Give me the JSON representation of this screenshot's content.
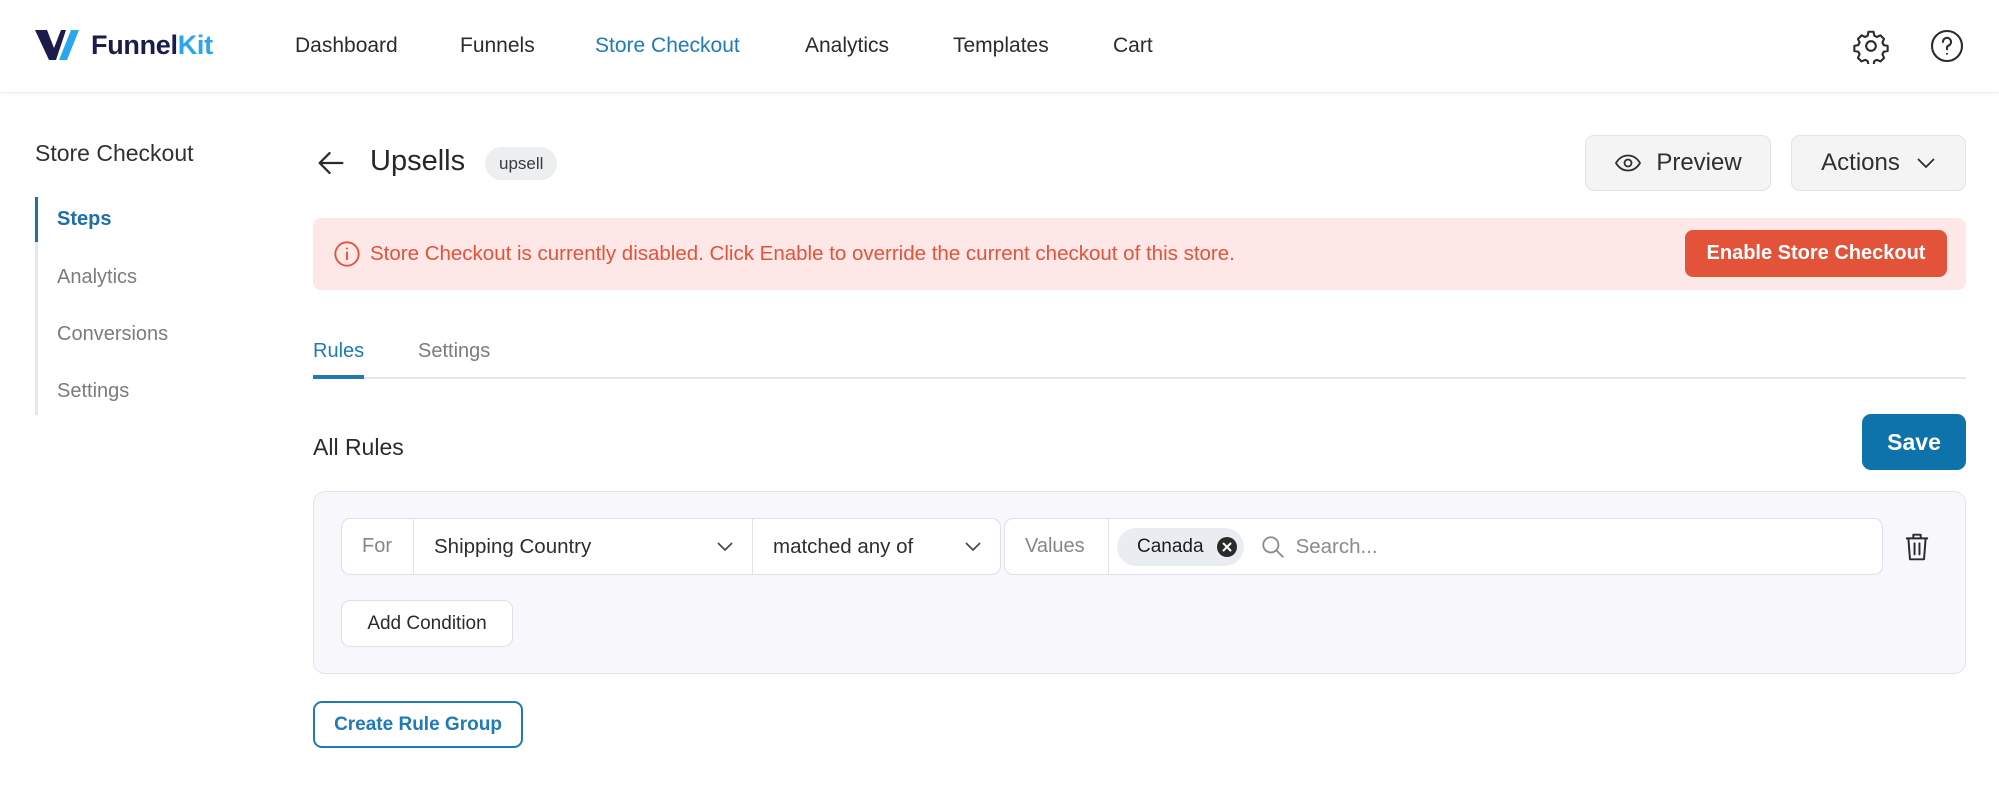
{
  "app": {
    "brand_part1": "Funnel",
    "brand_part2": "Kit",
    "colors": {
      "brand_dark": "#1c1b4d",
      "brand_light": "#2aa6ee",
      "accent": "#1f7ab6",
      "danger": "#e2533a",
      "alert_bg": "#fde7e7"
    }
  },
  "header": {
    "nav": [
      {
        "label": "Dashboard",
        "active": false
      },
      {
        "label": "Funnels",
        "active": false
      },
      {
        "label": "Store Checkout",
        "active": true
      },
      {
        "label": "Analytics",
        "active": false
      },
      {
        "label": "Templates",
        "active": false
      },
      {
        "label": "Cart",
        "active": false
      }
    ],
    "icons": [
      "gear-icon",
      "help-icon"
    ]
  },
  "sidebar": {
    "title": "Store Checkout",
    "items": [
      {
        "label": "Steps",
        "active": true
      },
      {
        "label": "Analytics",
        "active": false
      },
      {
        "label": "Conversions",
        "active": false
      },
      {
        "label": "Settings",
        "active": false
      }
    ]
  },
  "page": {
    "title": "Upsells",
    "badge": "upsell",
    "preview_label": "Preview",
    "actions_label": "Actions"
  },
  "alert": {
    "message": "Store Checkout is currently disabled. Click Enable to override the current checkout of this store.",
    "button_label": "Enable Store Checkout"
  },
  "tabs": [
    {
      "label": "Rules",
      "active": true
    },
    {
      "label": "Settings",
      "active": false
    }
  ],
  "rules": {
    "title": "All Rules",
    "save_label": "Save",
    "conditions": [
      {
        "for_label": "For",
        "field": "Shipping Country",
        "operator": "matched any of",
        "values_label": "Values",
        "values": [
          "Canada"
        ],
        "search_placeholder": "Search..."
      }
    ],
    "add_condition_label": "Add Condition",
    "create_group_label": "Create Rule Group"
  }
}
